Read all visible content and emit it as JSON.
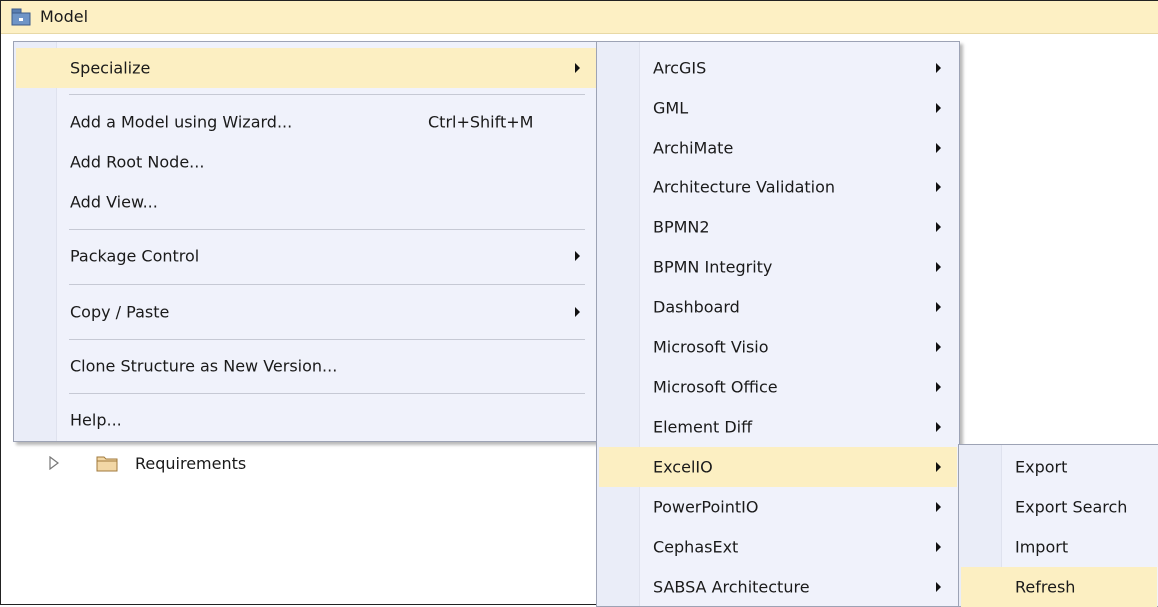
{
  "title": "Model",
  "tree": {
    "item_label": "Requirements"
  },
  "menu1": {
    "items": [
      {
        "label": "Specialize",
        "has_submenu": true,
        "highlighted": true
      },
      {
        "label": "Add a Model using Wizard...",
        "shortcut": "Ctrl+Shift+M"
      },
      {
        "label": "Add Root Node..."
      },
      {
        "label": "Add View..."
      },
      {
        "label": "Package Control",
        "has_submenu": true
      },
      {
        "label": "Copy / Paste",
        "has_submenu": true
      },
      {
        "label": "Clone Structure as New Version..."
      },
      {
        "label": "Help..."
      }
    ]
  },
  "menu2": {
    "items": [
      {
        "label": "ArcGIS",
        "has_submenu": true
      },
      {
        "label": "GML",
        "has_submenu": true
      },
      {
        "label": "ArchiMate",
        "has_submenu": true
      },
      {
        "label": "Architecture Validation",
        "has_submenu": true
      },
      {
        "label": "BPMN2",
        "has_submenu": true
      },
      {
        "label": "BPMN Integrity",
        "has_submenu": true
      },
      {
        "label": "Dashboard",
        "has_submenu": true
      },
      {
        "label": "Microsoft Visio",
        "has_submenu": true
      },
      {
        "label": "Microsoft Office",
        "has_submenu": true
      },
      {
        "label": "Element Diff",
        "has_submenu": true
      },
      {
        "label": "ExcelIO",
        "has_submenu": true,
        "highlighted": true
      },
      {
        "label": "PowerPointIO",
        "has_submenu": true
      },
      {
        "label": "CephasExt",
        "has_submenu": true
      },
      {
        "label": "SABSA Architecture",
        "has_submenu": true
      }
    ]
  },
  "menu3": {
    "items": [
      {
        "label": "Export"
      },
      {
        "label": "Export Search"
      },
      {
        "label": "Import"
      },
      {
        "label": "Refresh",
        "highlighted": true
      }
    ]
  },
  "colors": {
    "highlight": "#fcefc2",
    "menu_background": "#f0f2fb",
    "titlebar": "#fdf0c4"
  },
  "icons": {
    "title": "package-icon",
    "tree_expander": "triangle-right-icon",
    "tree_folder": "folder-icon",
    "submenu_arrow": "submenu-arrow-icon"
  }
}
